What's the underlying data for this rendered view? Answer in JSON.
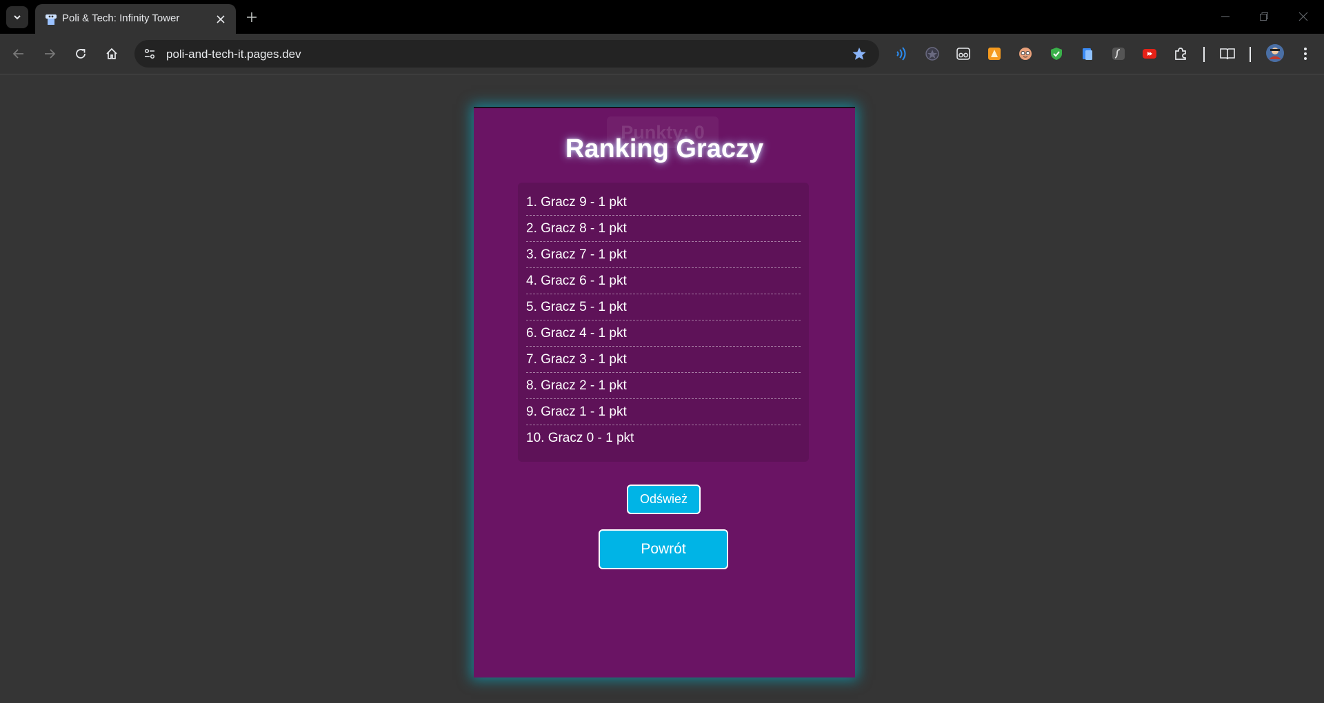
{
  "browser": {
    "tab_title": "Poli & Tech: Infinity Tower",
    "url": "poli-and-tech-it.pages.dev",
    "accent": "#8ab4f8"
  },
  "page": {
    "score_label": "Punkty: 0",
    "title": "Ranking Graczy",
    "ranking": [
      "1. Gracz 9 - 1 pkt",
      "2. Gracz 8 - 1 pkt",
      "3. Gracz 7 - 1 pkt",
      "4. Gracz 6 - 1 pkt",
      "5. Gracz 5 - 1 pkt",
      "6. Gracz 4 - 1 pkt",
      "7. Gracz 3 - 1 pkt",
      "8. Gracz 2 - 1 pkt",
      "9. Gracz 1 - 1 pkt",
      "10. Gracz 0 - 1 pkt"
    ],
    "refresh_label": "Odśwież",
    "back_label": "Powrót",
    "colors": {
      "panel": "#6a1464",
      "button": "#00b4e6",
      "glow": "#00bedc"
    }
  }
}
